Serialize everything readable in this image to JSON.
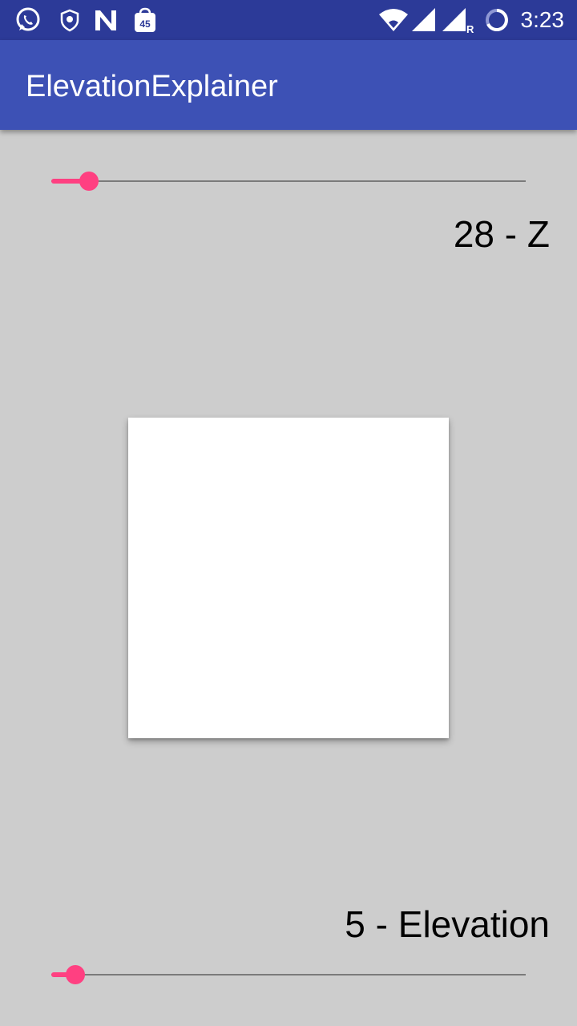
{
  "status_bar": {
    "time": "3:23",
    "left_icons": [
      "whatsapp-icon",
      "shield-icon",
      "n-icon",
      "badge-45-icon"
    ],
    "badge_count": "45",
    "right_icons": [
      "wifi-icon",
      "signal-icon",
      "signal-roaming-icon",
      "battery-circle-icon"
    ],
    "roaming_letter": "R"
  },
  "app_bar": {
    "title": "ElevationExplainer",
    "color": "#3d51b5"
  },
  "z_control": {
    "label": "28 - Z",
    "value": 28,
    "fraction": 0.08
  },
  "elevation_control": {
    "label": "5 - Elevation",
    "value": 5,
    "fraction": 0.05
  },
  "colors": {
    "accent": "#ff4081",
    "background": "#cdcdcd",
    "status_bar": "#2c3a98",
    "card": "#ffffff"
  }
}
